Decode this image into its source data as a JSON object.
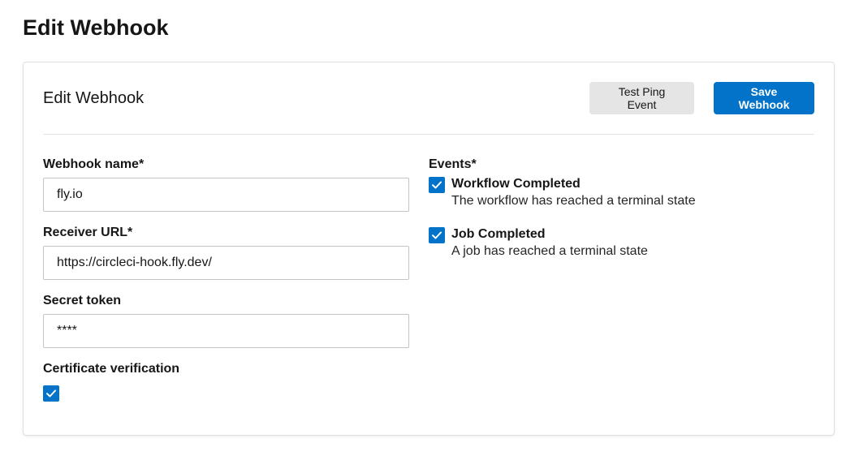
{
  "page": {
    "title": "Edit Webhook"
  },
  "card": {
    "title": "Edit Webhook",
    "test_button": "Test Ping Event",
    "save_button": "Save Webhook"
  },
  "form": {
    "name_label": "Webhook name*",
    "name_value": "fly.io",
    "url_label": "Receiver URL*",
    "url_value": "https://circleci-hook.fly.dev/",
    "secret_label": "Secret token",
    "secret_value": "****",
    "cert_label": "Certificate verification",
    "cert_checked": true
  },
  "events": {
    "label": "Events*",
    "items": [
      {
        "name": "Workflow Completed",
        "description": "The workflow has reached a terminal state",
        "checked": true
      },
      {
        "name": "Job Completed",
        "description": "A job has reached a terminal state",
        "checked": true
      }
    ]
  },
  "colors": {
    "primary": "#0273c8",
    "secondary_button": "#e5e5e5",
    "border": "#c4c4c4"
  }
}
